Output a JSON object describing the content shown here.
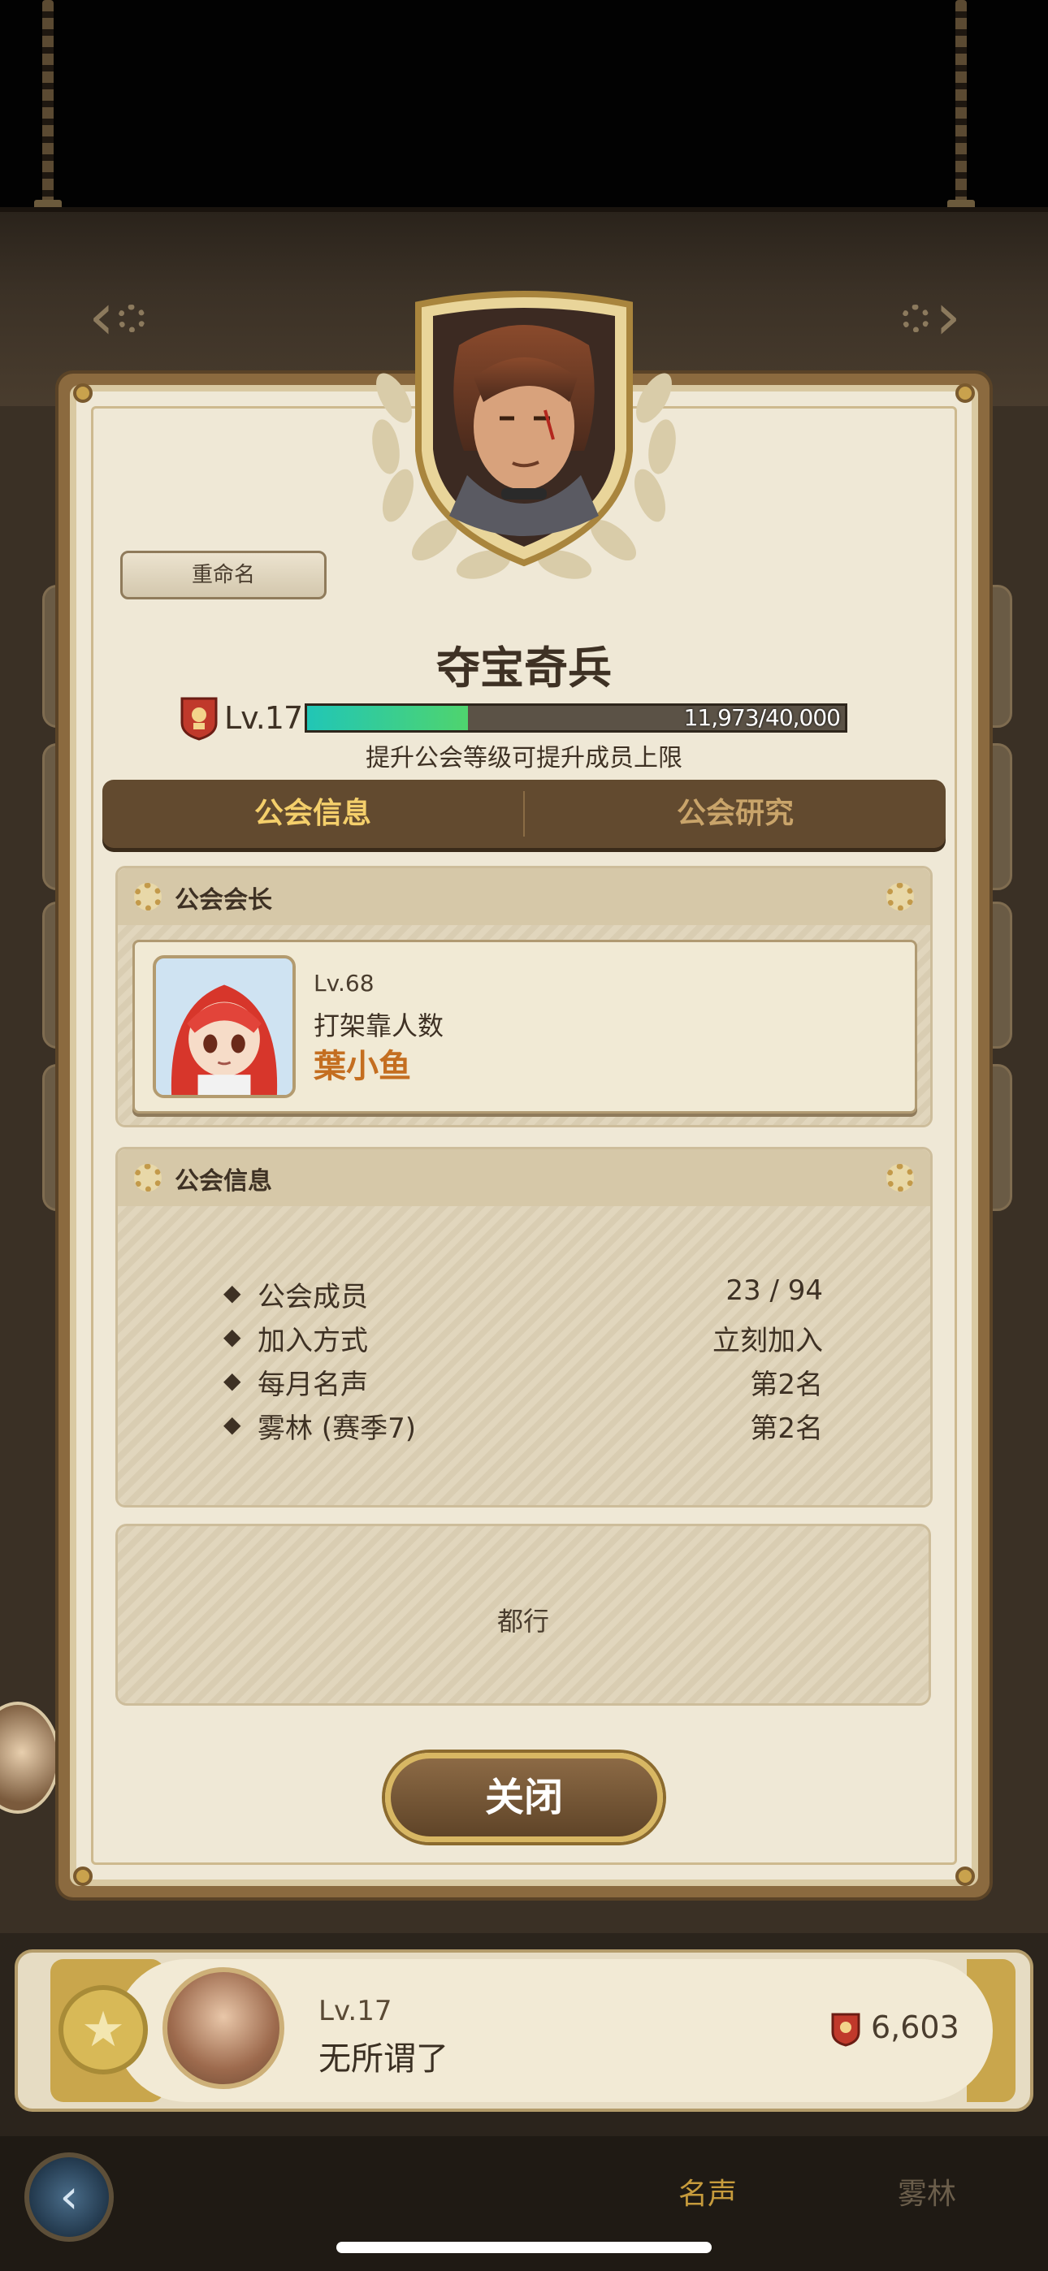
{
  "guild": {
    "rename_label": "重命名",
    "name": "夺宝奇兵",
    "level": "Lv.17",
    "xp_text": "11,973/40,000",
    "xp_current": 11973,
    "xp_max": 40000,
    "hint": "提升公会等级可提升成员上限"
  },
  "tabs": {
    "info": "公会信息",
    "research": "公会研究"
  },
  "leader_section": {
    "title": "公会会长",
    "level": "Lv.68",
    "title_text": "打架靠人数",
    "name": "葉小鱼"
  },
  "info_section": {
    "title": "公会信息",
    "rows": [
      {
        "label": "公会成员",
        "value": "23 / 94"
      },
      {
        "label": "加入方式",
        "value": "立刻加入"
      },
      {
        "label": "每月名声",
        "value": "第2名"
      },
      {
        "label": "雾林 (赛季7)",
        "value": "第2名"
      }
    ]
  },
  "notice": "都行",
  "close_label": "关闭",
  "member_row": {
    "level": "Lv.17",
    "name": "无所谓了",
    "fame": "6,603"
  },
  "bottom_tabs": {
    "fame": "名声",
    "mist": "雾林"
  },
  "icons": {
    "back": "back-arrow-icon",
    "prev": "chevron-left-icon",
    "next": "chevron-right-icon",
    "star": "star-icon"
  },
  "colors": {
    "accent_gold": "#f4cf6b",
    "leader_name": "#c46e20",
    "xp_fill": "#21c6b6"
  }
}
